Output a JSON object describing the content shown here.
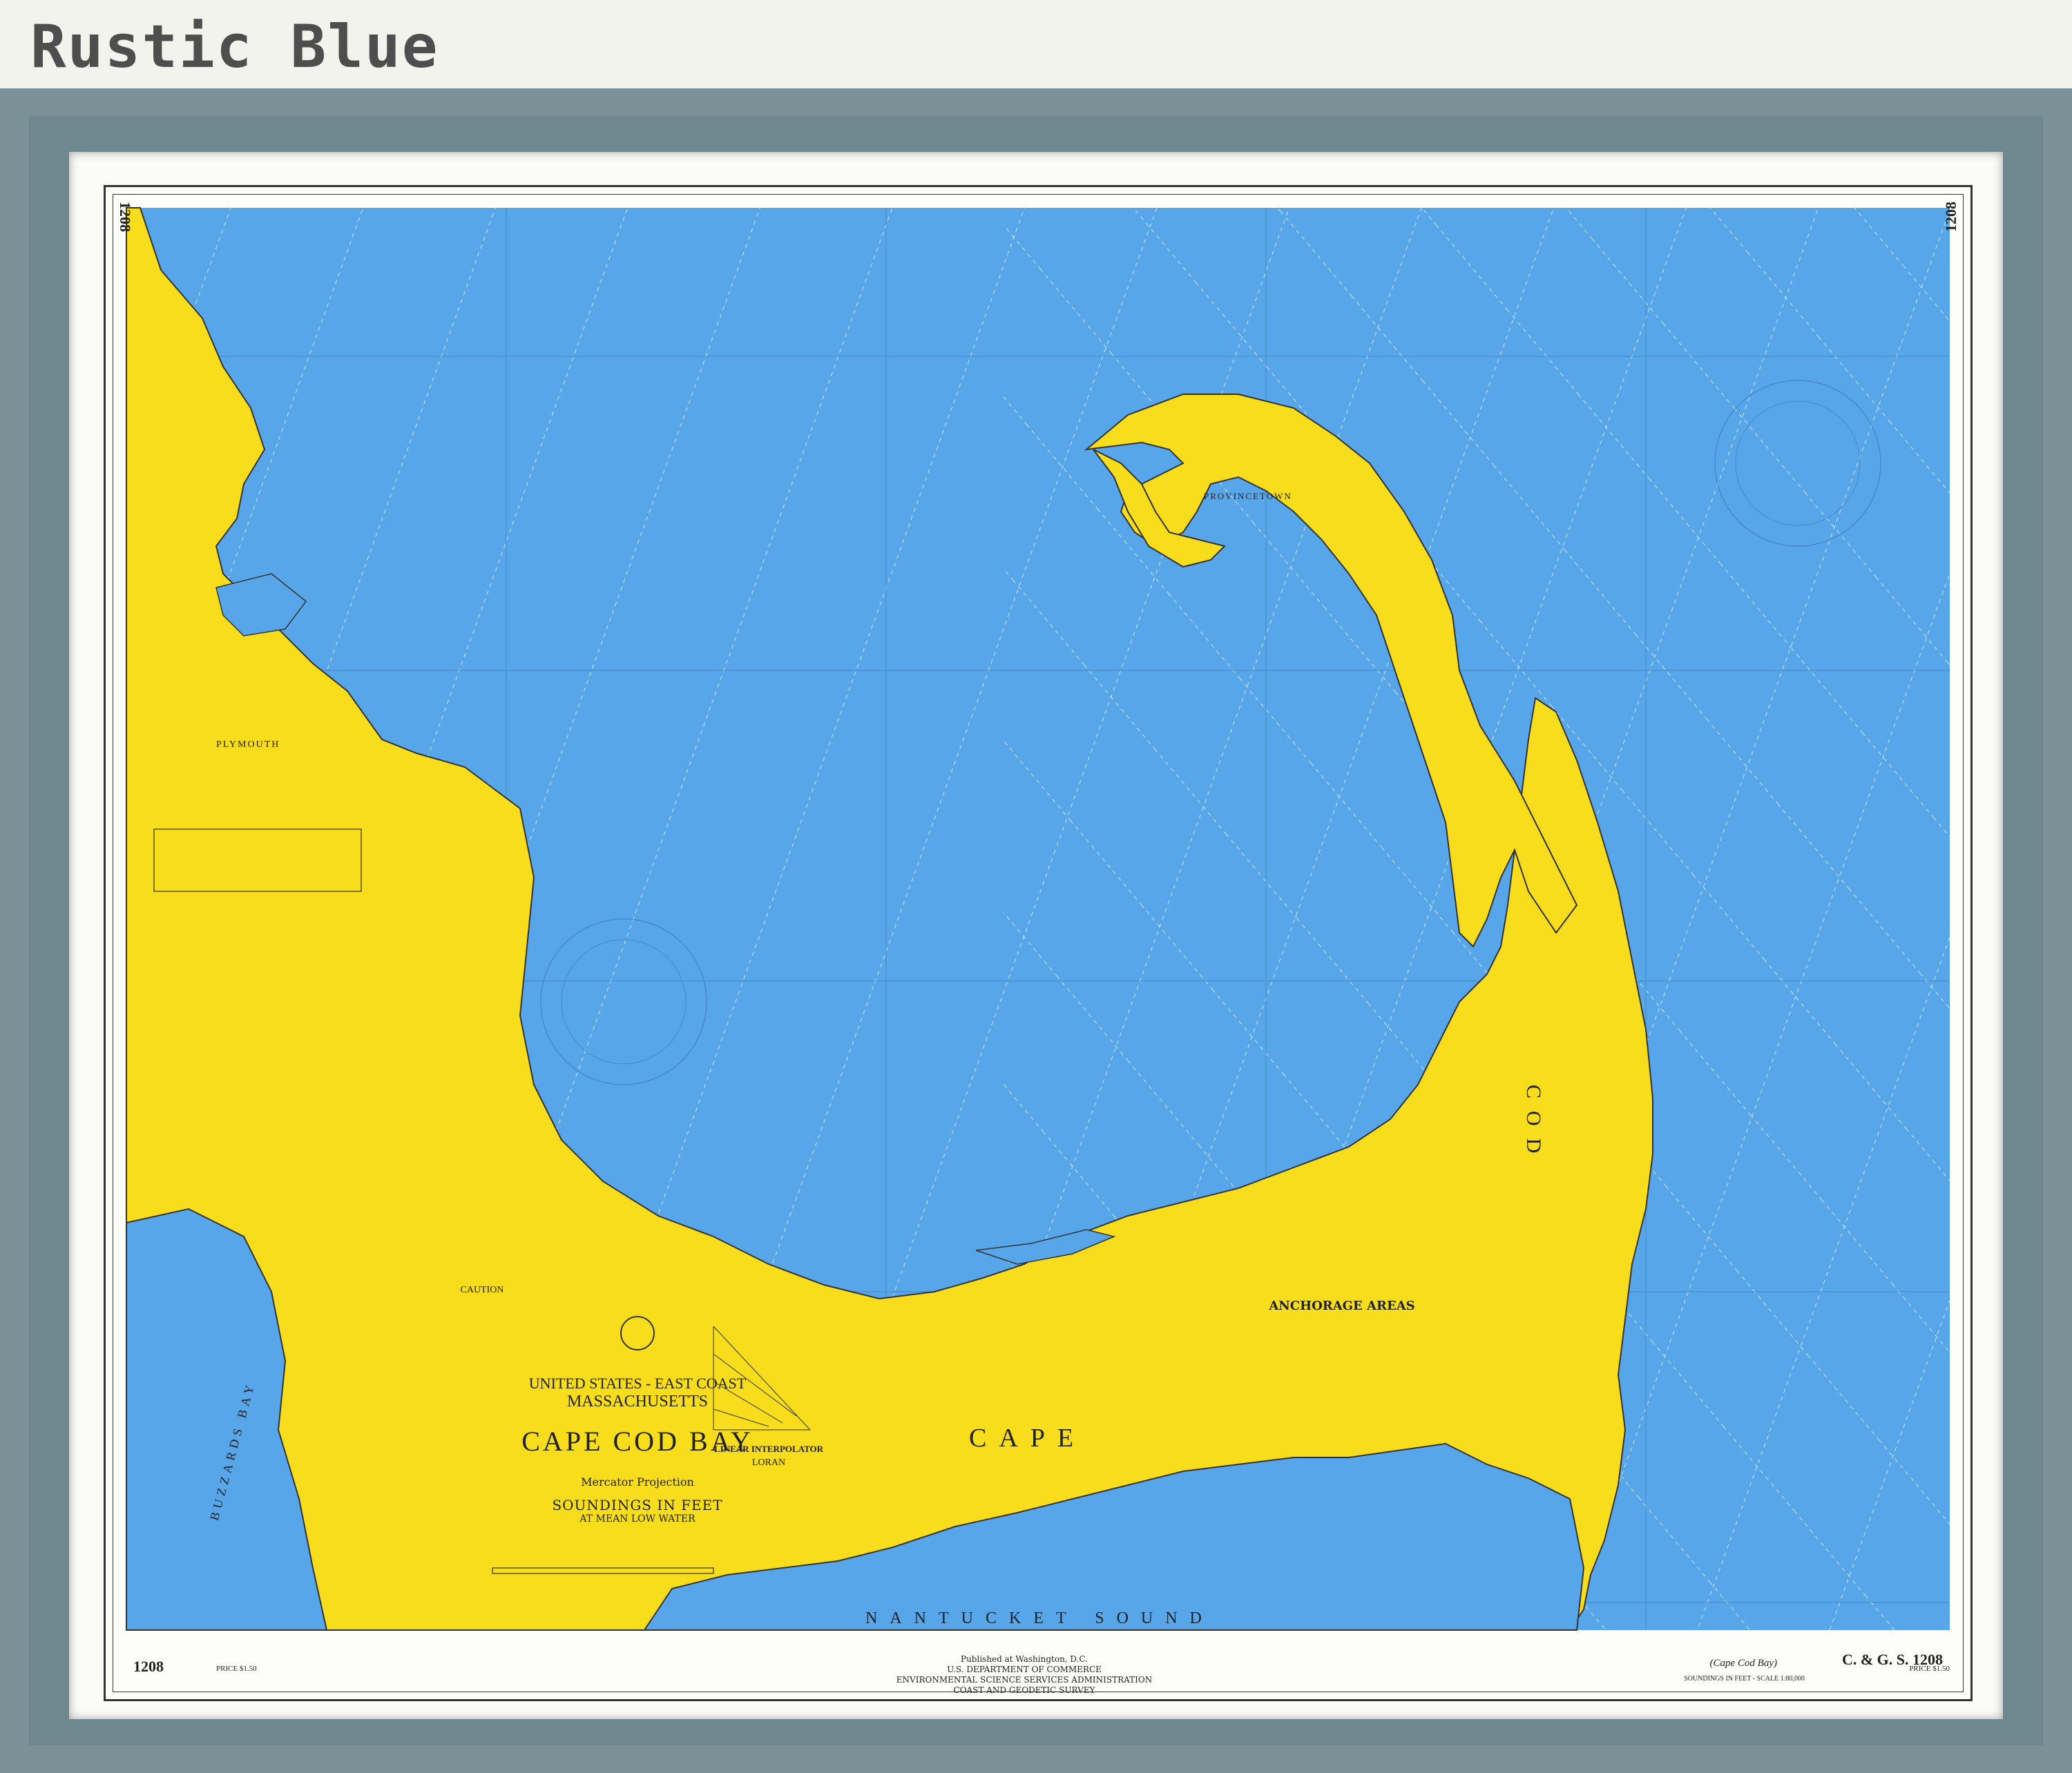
{
  "header": {
    "label": "Rustic Blue"
  },
  "chart": {
    "number": "1208",
    "price": "PRICE $1.50",
    "title_line1": "UNITED STATES - EAST COAST",
    "title_line2": "MASSACHUSETTS",
    "title_main": "CAPE COD BAY",
    "projection": "Mercator Projection",
    "soundings_line1": "SOUNDINGS IN FEET",
    "soundings_line2": "AT MEAN LOW WATER",
    "anchorage_title": "ANCHORAGE AREAS",
    "caution": "CAUTION",
    "loran": "LORAN",
    "linear_interpolator": "LINEAR INTERPOLATOR",
    "published_line1": "Published at Washington, D.C.",
    "published_line2": "U.S. DEPARTMENT OF COMMERCE",
    "published_line3": "ENVIRONMENTAL SCIENCE SERVICES ADMINISTRATION",
    "published_line4": "COAST AND GEODETIC SURVEY",
    "bottom_right_title": "(Cape Cod Bay)",
    "bottom_right_code": "C. & G. S. 1208",
    "soundings_note": "SOUNDINGS IN FEET - SCALE 1:80,000",
    "place_labels": {
      "cape": "CAPE",
      "cod": "COD",
      "nantucket_sound": "NANTUCKET SOUND",
      "plymouth": "PLYMOUTH",
      "provincetown": "PROVINCETOWN",
      "buzzards_bay": "BUZZARDS BAY"
    }
  },
  "colors": {
    "water": "#58a6ea",
    "land": "#f8dd1c",
    "frame": "#7a9198",
    "mat": "#fbfbf7"
  }
}
